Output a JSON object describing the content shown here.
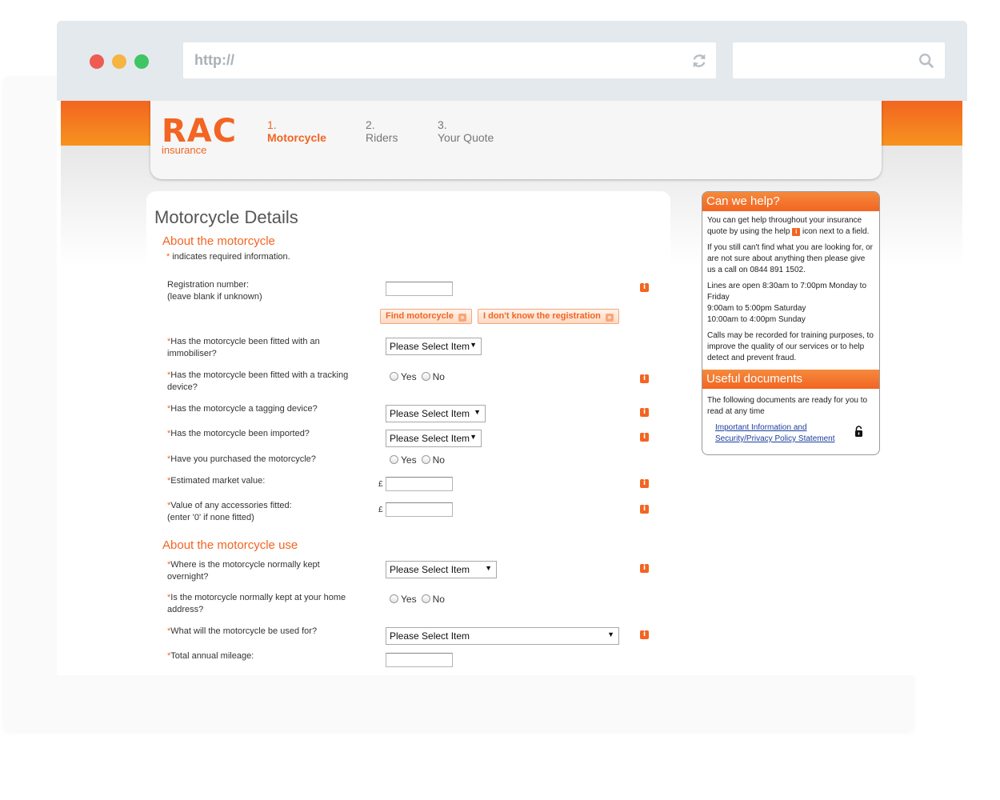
{
  "browser": {
    "url_text": "http://",
    "icons": [
      "reload-icon",
      "search-icon"
    ]
  },
  "header": {
    "logo_word": "RAC",
    "logo_sub": "insurance",
    "steps": [
      {
        "num": "1.",
        "label": "Motorcycle",
        "active": true
      },
      {
        "num": "2.",
        "label": "Riders",
        "active": false
      },
      {
        "num": "3.",
        "label": "Your Quote",
        "active": false
      }
    ]
  },
  "form": {
    "title": "Motorcycle Details",
    "section1": "About the motorcycle",
    "required_star": "*",
    "required_note": " indicates required information.",
    "section2": "About the motorcycle use",
    "reg_label_1": "Registration number:",
    "reg_label_2": "(leave blank if unknown)",
    "btn_find": "Find motorcycle",
    "btn_dont_know": "I don't know the registration",
    "q_immobiliser": "Has the motorcycle been fitted with an immobiliser?",
    "q_tracking": "Has the motorcycle been fitted with a tracking device?",
    "q_tagging": "Has the motorcycle a tagging device?",
    "q_imported": "Has the motorcycle been imported?",
    "q_purchased": "Have you purchased the motorcycle?",
    "q_market_value": "Estimated market value:",
    "q_accessories_1": "Value of any accessories fitted:",
    "q_accessories_2": "(enter '0' if none fitted)",
    "q_overnight": "Where is the motorcycle normally kept overnight?",
    "q_home": "Is the motorcycle normally kept at your home address?",
    "q_used_for": "What will the motorcycle be used for?",
    "q_mileage": "Total annual mileage:",
    "select_placeholder": "Please Select Item",
    "yes": "Yes",
    "no": "No",
    "pound": "£",
    "info_glyph": "i",
    "arrow_glyph": "▼"
  },
  "help": {
    "title1": "Can we help?",
    "p1a": "You can get help throughout your insurance quote by using the help ",
    "p1b": " icon next to a field.",
    "p2": "If you still can't find what you are looking for, or are not sure about anything then please give us a call on 0844 891 1502.",
    "p3a": "Lines are open 8:30am to 7:00pm Monday to Friday",
    "p3b": "9:00am to 5:00pm Saturday",
    "p3c": "10:00am to 4:00pm Sunday",
    "p4": "Calls may be recorded for training purposes, to improve the quality of our services or to help detect and prevent fraud.",
    "title2": "Useful documents",
    "p5": "The following documents are ready for you to read at any time",
    "doc_link": "Important Information and Security/Privacy Policy Statement"
  },
  "colors": {
    "brand": "#f26522",
    "link": "#1a3e9c"
  }
}
